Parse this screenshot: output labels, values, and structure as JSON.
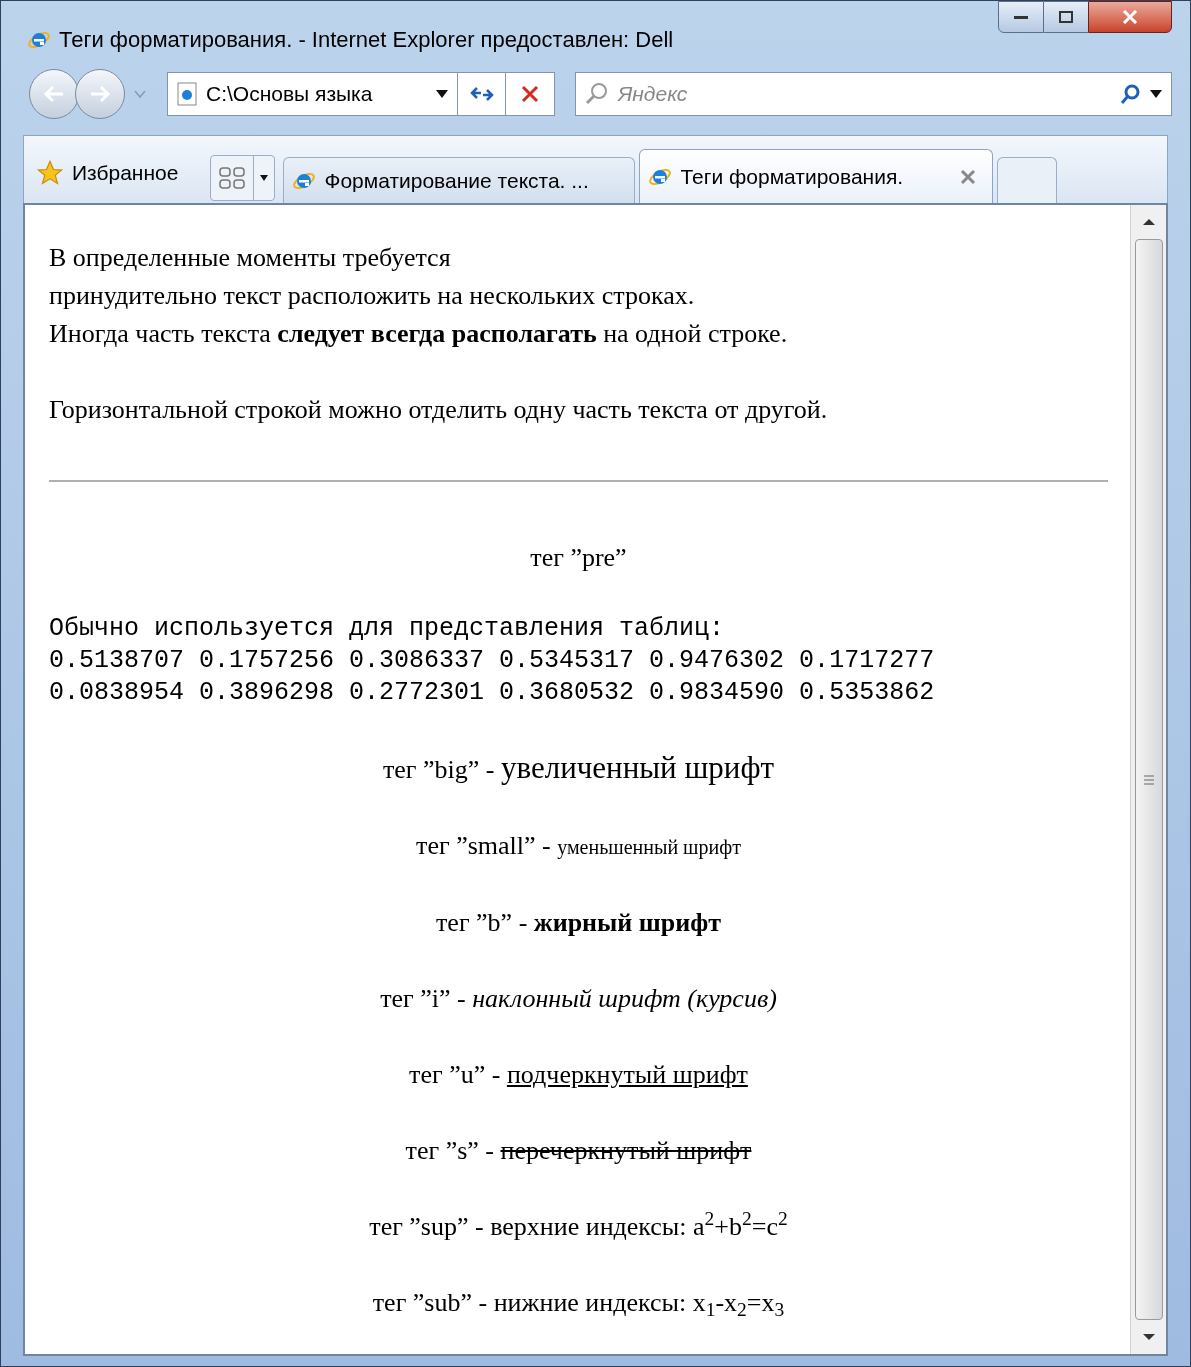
{
  "window": {
    "title": "Теги форматирования. - Internet Explorer предоставлен: Dell"
  },
  "address_bar": {
    "value": "C:\\Основы языка"
  },
  "search": {
    "placeholder": "Яндекс"
  },
  "favorites": {
    "label": "Избранное"
  },
  "tabs": [
    {
      "label": "Форматирование текста. ...",
      "selected": false
    },
    {
      "label": "Теги форматирования.",
      "selected": true
    }
  ],
  "content": {
    "paragraph_lines": [
      "В определенные моменты требуется",
      "принудительно текст расположить на нескольких строках.",
      "Иногда часть текста **следует всегда располагать** на одной строке."
    ],
    "lead": "Горизонтальной строкой можно отделить одну часть текста от другой.",
    "pre_heading": "тег ”pre”",
    "pre_lines": [
      "Обычно используется для представления таблиц:",
      "0.5138707 0.1757256 0.3086337 0.5345317 0.9476302 0.1717277",
      "0.0838954 0.3896298 0.2772301 0.3680532 0.9834590 0.5353862"
    ],
    "demos": [
      {
        "kind": "big",
        "label": "тег ”big” -",
        "sample": "увеличенный шрифт"
      },
      {
        "kind": "small",
        "label": "тег ”small” -",
        "sample": "уменьшенный шрифт"
      },
      {
        "kind": "bold",
        "label": "тег ”b” -",
        "sample": "жирный шрифт"
      },
      {
        "kind": "italic",
        "label": "тег ”i” -",
        "sample": "наклонный шрифт (курсив)"
      },
      {
        "kind": "underline",
        "label": "тег ”u” -",
        "sample": "подчеркнутый шрифт"
      },
      {
        "kind": "strike",
        "label": "тег ”s” -",
        "sample": "перечеркнутый шрифт"
      },
      {
        "kind": "sup",
        "label": "тег ”sup” - верхние индексы:",
        "sample": "a$^{2}$+b$^{2}$=c$^{2}$"
      },
      {
        "kind": "sub",
        "label": "тег ”sub” - нижние индексы:",
        "sample": "x$_{1}$-x$_{2}$=x$_{3}$"
      }
    ]
  }
}
